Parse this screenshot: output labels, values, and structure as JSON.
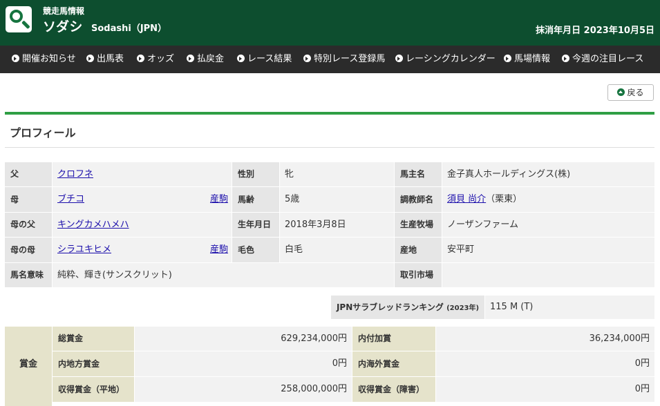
{
  "header": {
    "site_label": "競走馬情報",
    "horse_name_jp": "ソダシ",
    "horse_name_en": "Sodashi（JPN）",
    "retired_date": "抹消年月日 2023年10月5日"
  },
  "nav": [
    "開催お知らせ",
    "出馬表",
    "オッズ",
    "払戻金",
    "レース結果",
    "特別レース登録馬",
    "レーシングカレンダー",
    "馬場情報",
    "今週の注目レース"
  ],
  "back_label": "戻る",
  "section_title": "プロフィール",
  "profile": {
    "sire_label": "父",
    "sire": "クロフネ",
    "dam_label": "母",
    "dam": "ブチコ",
    "dam_extra": "産駒",
    "damsire_label": "母の父",
    "damsire": "キングカメハメハ",
    "granddam_label": "母の母",
    "granddam": "シラユキヒメ",
    "granddam_extra": "産駒",
    "meaning_label": "馬名意味",
    "meaning": "純粋、輝き(サンスクリット)",
    "sex_label": "性別",
    "sex": "牝",
    "age_label": "馬齢",
    "age": "5歳",
    "birth_label": "生年月日",
    "birth": "2018年3月8日",
    "color_label": "毛色",
    "color": "白毛",
    "owner_label": "馬主名",
    "owner": "金子真人ホールディングス(株)",
    "trainer_label": "調教師名",
    "trainer": "須貝 尚介",
    "trainer_extra": "（栗東）",
    "breeder_label": "生産牧場",
    "breeder": "ノーザンファーム",
    "origin_label": "産地",
    "origin": "安平町",
    "market_label": "取引市場",
    "market": ""
  },
  "ranking": {
    "label": "JPNサラブレッドランキング",
    "year": "(2023年)",
    "value": "115 M (T)"
  },
  "earnings": {
    "header": "賞金",
    "total_label": "総賞金",
    "total": "629,234,000円",
    "added_label": "内付加賞",
    "added": "36,234,000円",
    "local_label": "内地方賞金",
    "local": "0円",
    "overseas_label": "内海外賞金",
    "overseas": "0円",
    "flat_label": "収得賞金（平地）",
    "flat": "258,000,000円",
    "jump_label": "収得賞金（障害）",
    "jump": "0円"
  },
  "colors": {
    "header_bg": "#0d4e2f",
    "nav_bg": "#2b2b2b",
    "accent": "#2f9e44"
  }
}
